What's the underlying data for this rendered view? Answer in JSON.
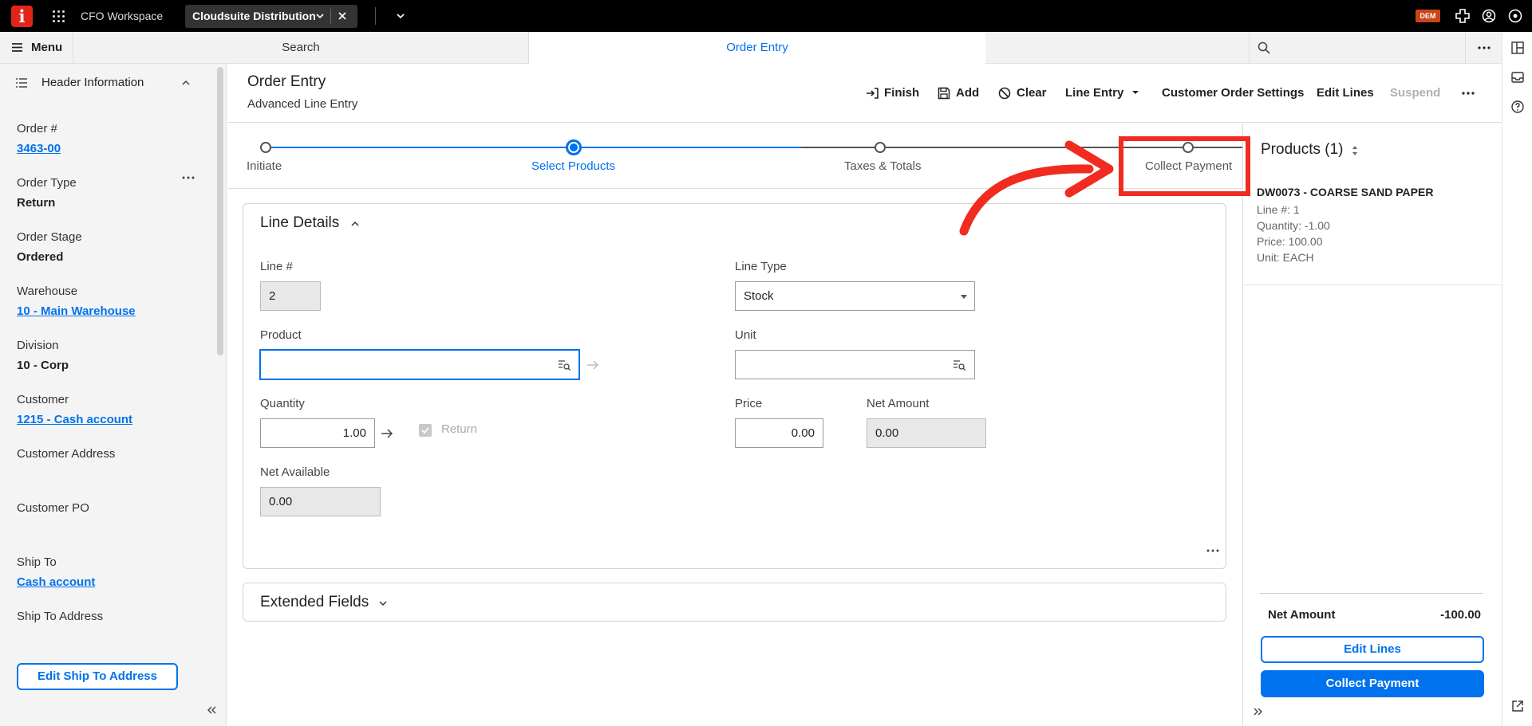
{
  "topbar": {
    "logo": "i",
    "workspace": "CFO Workspace",
    "active_tab": "Cloudsuite Distribution",
    "env_badge": "DEM"
  },
  "navbar": {
    "menu_label": "Menu",
    "tabs": [
      {
        "label": "Search"
      },
      {
        "label": "Order Entry"
      }
    ],
    "search_placeholder": ""
  },
  "sidebar": {
    "title": "Header Information",
    "fields": [
      {
        "label": "Order #",
        "value": "3463-00",
        "link": true
      },
      {
        "label": "Order Type",
        "value": "Return",
        "link": false
      },
      {
        "label": "Order Stage",
        "value": "Ordered",
        "link": false
      },
      {
        "label": "Warehouse",
        "value": "10 - Main Warehouse",
        "link": true
      },
      {
        "label": "Division",
        "value": "10 - Corp",
        "link": false
      },
      {
        "label": "Customer",
        "value": "1215 - Cash account",
        "link": true
      },
      {
        "label": "Customer Address",
        "value": "",
        "link": false
      },
      {
        "label": "Customer PO",
        "value": "",
        "link": false
      },
      {
        "label": "Ship To",
        "value": "Cash account",
        "link": true
      },
      {
        "label": "Ship To Address",
        "value": "",
        "link": false
      }
    ],
    "edit_ship_button": "Edit Ship To Address"
  },
  "header": {
    "title": "Order Entry",
    "subtitle": "Advanced Line Entry",
    "actions": {
      "finish": "Finish",
      "add": "Add",
      "clear": "Clear",
      "line_entry": "Line Entry",
      "customer_settings": "Customer Order Settings",
      "edit_lines": "Edit Lines",
      "suspend": "Suspend"
    }
  },
  "stepper": {
    "steps": [
      "Initiate",
      "Select Products",
      "Taxes & Totals",
      "Collect Payment"
    ],
    "active_index": 1
  },
  "line_details": {
    "title": "Line Details",
    "line_no_label": "Line #",
    "line_no": "2",
    "line_type_label": "Line Type",
    "line_type": "Stock",
    "product_label": "Product",
    "product": "",
    "unit_label": "Unit",
    "unit": "",
    "quantity_label": "Quantity",
    "quantity": "1.00",
    "return_label": "Return",
    "price_label": "Price",
    "price": "0.00",
    "net_amount_label": "Net Amount",
    "net_amount": "0.00",
    "net_available_label": "Net Available",
    "net_available": "0.00"
  },
  "extended": {
    "title": "Extended Fields"
  },
  "products_panel": {
    "title": "Products (1)",
    "item": {
      "name": "DW0073 - COARSE SAND PAPER",
      "line": "Line #: 1",
      "quantity": "Quantity: -1.00",
      "price": "Price: 100.00",
      "unit": "Unit: EACH"
    },
    "net_amount_label": "Net Amount",
    "net_amount": "-100.00",
    "edit_lines_button": "Edit Lines",
    "collect_payment_button": "Collect Payment"
  },
  "colors": {
    "accent": "#0072ed",
    "brand": "#e1251b",
    "annotation": "#f02b1f"
  }
}
